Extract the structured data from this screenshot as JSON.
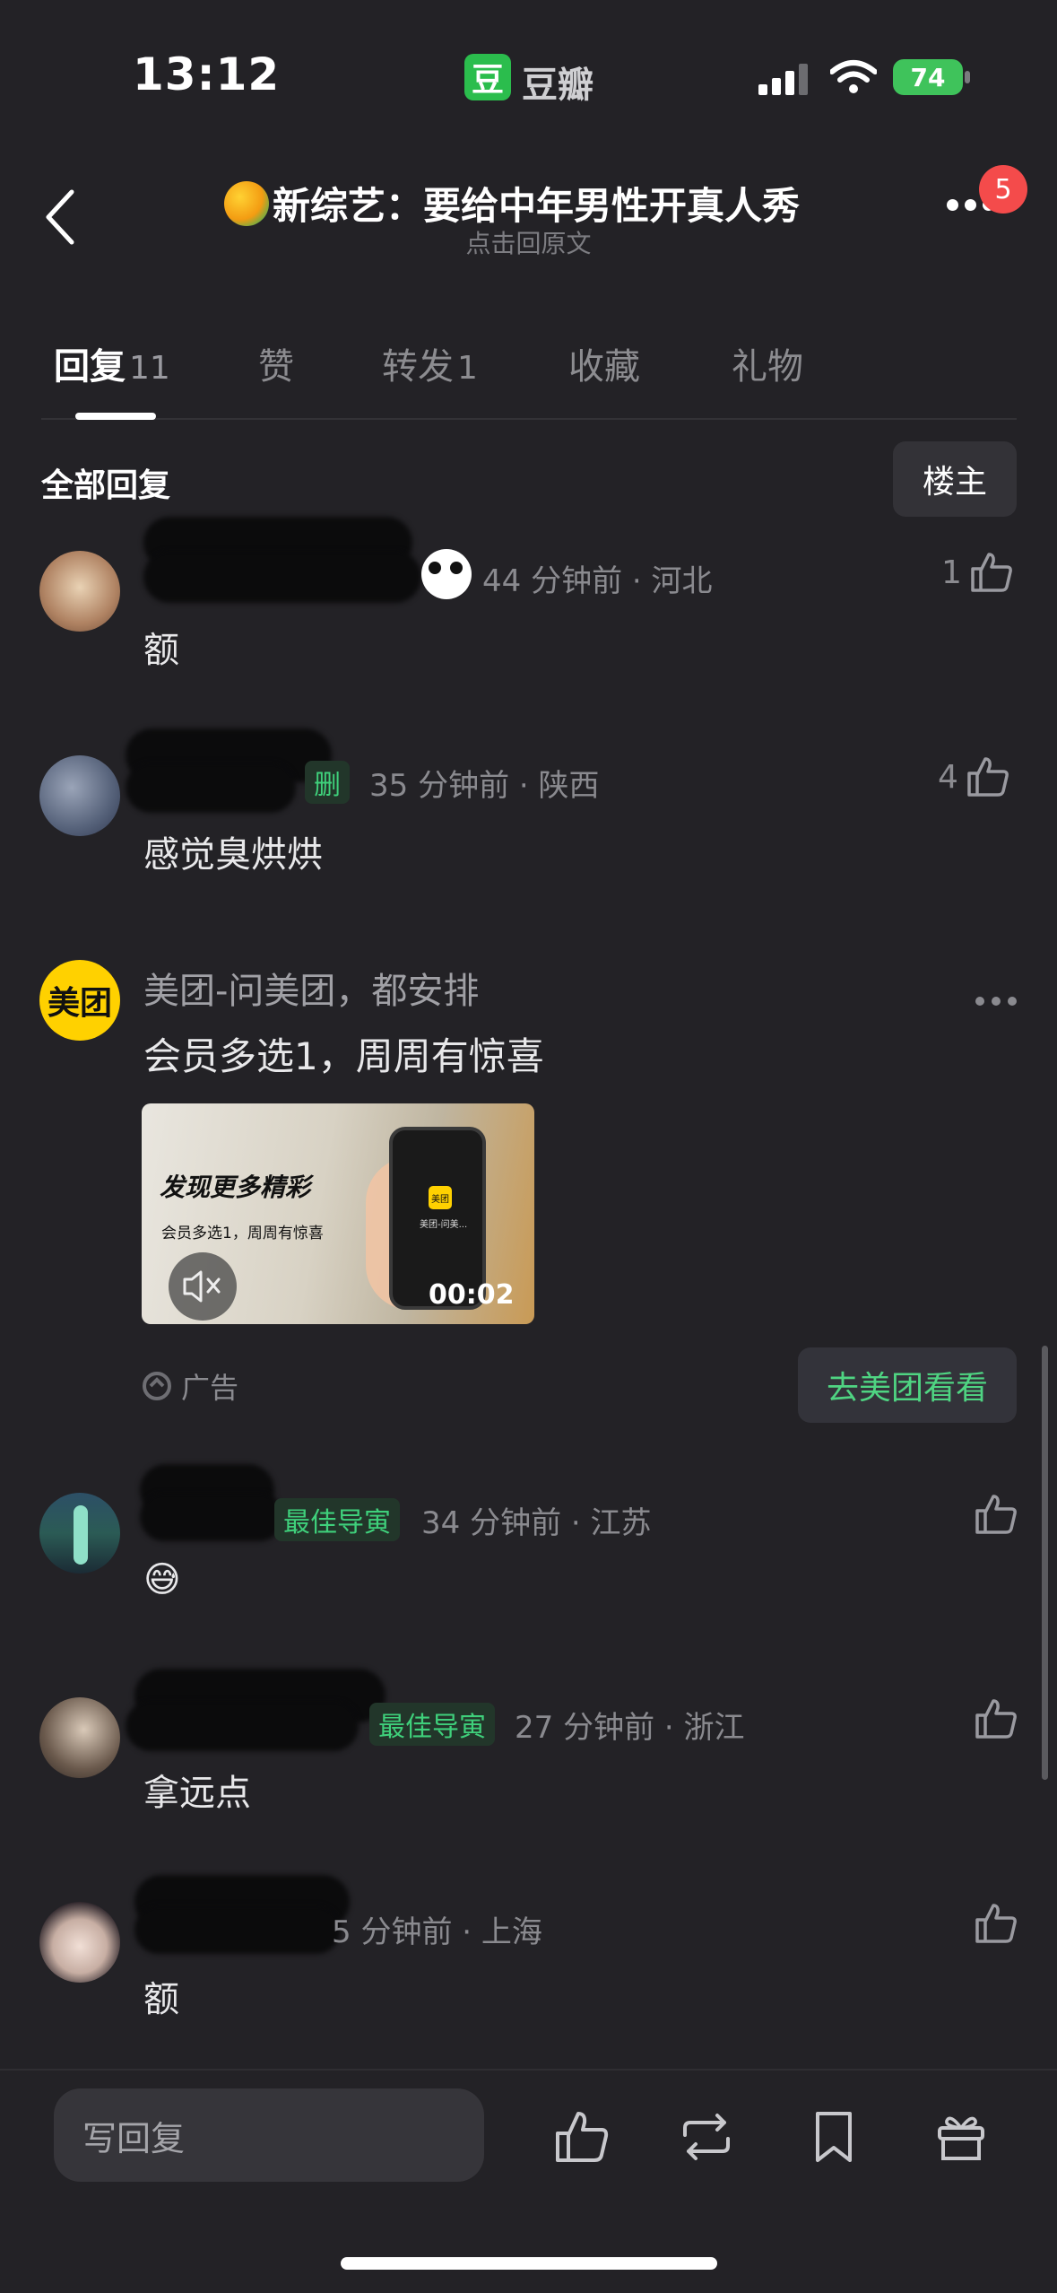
{
  "status_bar": {
    "time": "13:12",
    "app_name": "豆瓣",
    "app_logo": "豆",
    "battery": "74"
  },
  "nav": {
    "title": "新综艺：要给中年男性开真人秀",
    "subtitle": "点击回原文",
    "notification_count": "5"
  },
  "tabs": [
    {
      "label": "回复",
      "count": "11",
      "active": true
    },
    {
      "label": "赞",
      "count": ""
    },
    {
      "label": "转发",
      "count": "1"
    },
    {
      "label": "收藏",
      "count": ""
    },
    {
      "label": "礼物",
      "count": ""
    }
  ],
  "section": {
    "title": "全部回复",
    "filter_button": "楼主"
  },
  "comments": [
    {
      "meta": "44 分钟前 · 河北",
      "text": "额",
      "likes": "1"
    },
    {
      "tag": "删",
      "meta": "35 分钟前 · 陕西",
      "text": "感觉臭烘烘",
      "likes": "4"
    },
    {
      "tag": "最佳导寅",
      "meta": "34 分钟前 · 江苏",
      "text": "😅",
      "likes": ""
    },
    {
      "tag": "最佳导寅",
      "meta": "27 分钟前 · 浙江",
      "text": "拿远点",
      "likes": ""
    },
    {
      "meta": "5 分钟前 · 上海",
      "text": "额",
      "likes": ""
    }
  ],
  "ad": {
    "logo": "美团",
    "name": "美团-问美团，都安排",
    "text": "会员多选1，周周有惊喜",
    "video_headline": "发现更多精彩",
    "video_subline": "会员多选1，周周有惊喜",
    "phone_logo": "美团",
    "phone_text": "美团-问美...",
    "duration": "00:02",
    "label": "广告",
    "cta": "去美团看看"
  },
  "bottom_bar": {
    "reply_placeholder": "写回复"
  }
}
